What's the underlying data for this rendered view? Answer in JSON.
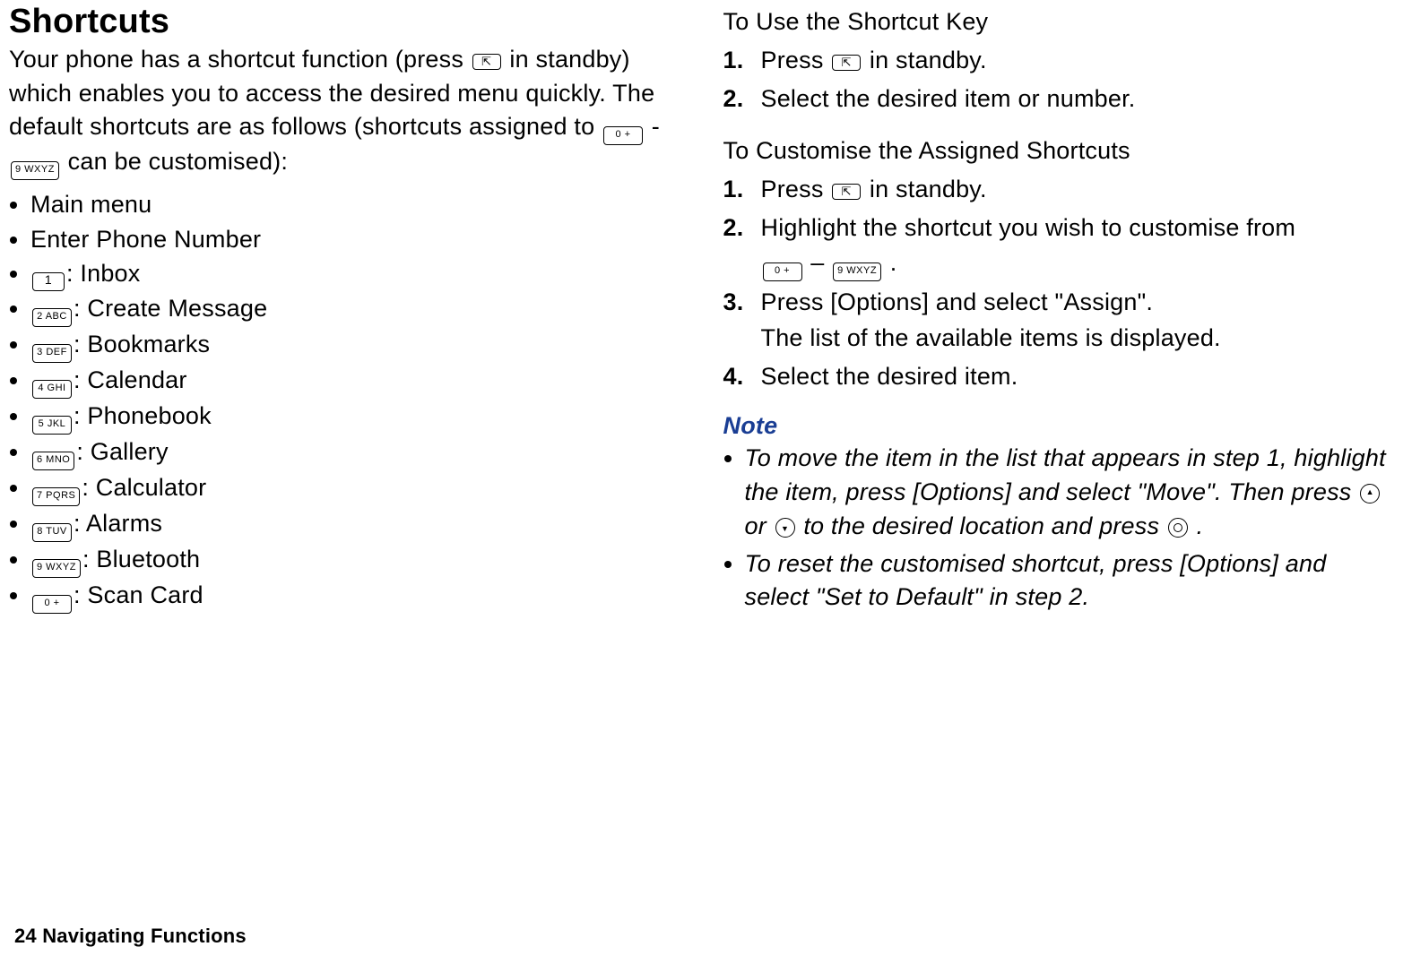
{
  "left": {
    "title": "Shortcuts",
    "intro_part1": "Your phone has a shortcut function (press ",
    "intro_part2": " in standby) which enables you to access the desired menu quickly. The default shortcuts are as follows (shortcuts assigned to ",
    "intro_part3": " - ",
    "intro_part4": " can be customised):",
    "range_start": "0 +",
    "range_end": "9 WXYZ",
    "items": [
      {
        "key": null,
        "label": "Main menu"
      },
      {
        "key": null,
        "label": "Enter Phone Number"
      },
      {
        "key": "1",
        "label": "Inbox"
      },
      {
        "key": "2 ABC",
        "label": "Create Message"
      },
      {
        "key": "3 DEF",
        "label": "Bookmarks"
      },
      {
        "key": "4 GHI",
        "label": "Calendar"
      },
      {
        "key": "5 JKL",
        "label": "Phonebook"
      },
      {
        "key": "6 MNO",
        "label": "Gallery"
      },
      {
        "key": "7 PQRS",
        "label": "Calculator"
      },
      {
        "key": "8 TUV",
        "label": "Alarms"
      },
      {
        "key": "9 WXYZ",
        "label": "Bluetooth"
      },
      {
        "key": "0 +",
        "label": "Scan Card"
      }
    ]
  },
  "right": {
    "use_head": "To Use the Shortcut Key",
    "use_steps": [
      {
        "num": "1.",
        "text_before": "Press ",
        "shortcut_key": true,
        "text_after": " in standby."
      },
      {
        "num": "2.",
        "text_before": "Select the desired item or number.",
        "shortcut_key": false,
        "text_after": ""
      }
    ],
    "cust_head": "To Customise the Assigned Shortcuts",
    "cust_step1_before": "Press ",
    "cust_step1_after": " in standby.",
    "cust_step2_line1": "Highlight the shortcut you wish to customise from",
    "cust_step2_sep": " – ",
    "cust_step2_end": ".",
    "cust_step2_key_start": "0 +",
    "cust_step2_key_end": "9 WXYZ",
    "cust_step3_line1": "Press [Options] and select \"Assign\".",
    "cust_step3_line2": "The list of the available items is displayed.",
    "cust_step4": "Select the desired item.",
    "note_head": "Note",
    "note1_a": "To move the item in the list that appears in step 1, highlight the item, press [Options] and select \"Move\". Then press ",
    "note1_b": " or ",
    "note1_c": " to the desired location and press ",
    "note1_d": ".",
    "note2": "To reset the customised shortcut, press [Options] and select \"Set to Default\" in step 2."
  },
  "footer": {
    "page": "24",
    "sep": "    ",
    "title": "Navigating Functions"
  }
}
